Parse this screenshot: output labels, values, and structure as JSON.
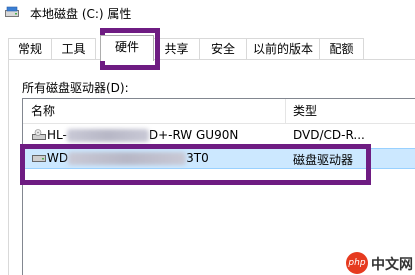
{
  "window": {
    "title": "本地磁盘 (C:) 属性"
  },
  "tabs": [
    {
      "label": "常规"
    },
    {
      "label": "工具"
    },
    {
      "label": "硬件"
    },
    {
      "label": "共享"
    },
    {
      "label": "安全"
    },
    {
      "label": "以前的版本"
    },
    {
      "label": "配额"
    }
  ],
  "hardware": {
    "section_label": "所有磁盘驱动器(D):",
    "columns": {
      "name": "名称",
      "type": "类型"
    },
    "rows": [
      {
        "name_prefix": "HL-",
        "name_suffix": "D+-RW GU90N",
        "type": "DVD/CD-R..."
      },
      {
        "name_prefix": "WD",
        "name_suffix": "3T0",
        "type": "磁盘驱动器"
      }
    ]
  },
  "watermark": {
    "logo_text": "php",
    "text": "中文网"
  },
  "colors": {
    "annotation": "#6e1c82",
    "selection": "#cce8ff",
    "selection_border": "#99d1ff"
  }
}
